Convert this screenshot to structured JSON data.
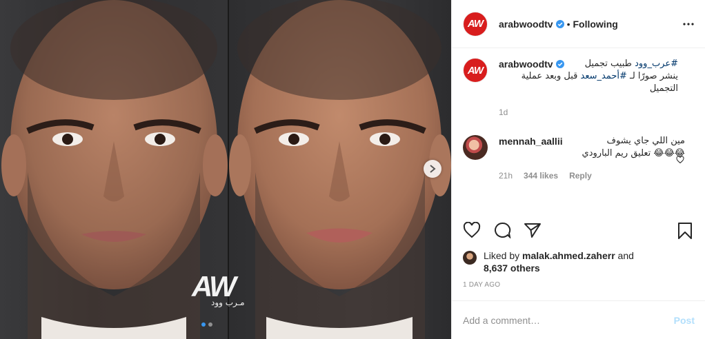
{
  "post": {
    "username": "arabwoodtv",
    "avatar_text": "AW",
    "follow_label": "Following",
    "separator": "•",
    "watermark": "AW",
    "watermark_sub": "مـرب وود",
    "carousel": {
      "total_slides": 2,
      "active_index": 0
    }
  },
  "caption": {
    "username": "arabwoodtv",
    "hashtag1": "#عرب_وود",
    "text1": " طبيب تجميل",
    "text2": "ينشر صورًا لـ ",
    "hashtag2": "#أحمد_سعد",
    "text3": " قبل وبعد عملية",
    "text4": "التجميل",
    "time": "1d"
  },
  "comment": {
    "username": "mennah_aallii",
    "line1": "مين اللي جاي يشوف",
    "line2": "😂😂😂 تعليق ريم البارودي",
    "time": "21h",
    "likes": "344 likes",
    "reply": "Reply"
  },
  "likes": {
    "prefix": "Liked by ",
    "user": "malak.ahmed.zaherr",
    "suffix": " and",
    "others": "8,637 others"
  },
  "date": "1 DAY AGO",
  "add_comment": {
    "placeholder": "Add a comment…",
    "post": "Post"
  },
  "colors": {
    "brand_red": "#d81d1d",
    "link": "#00376b",
    "active_dot": "#3897f0"
  }
}
